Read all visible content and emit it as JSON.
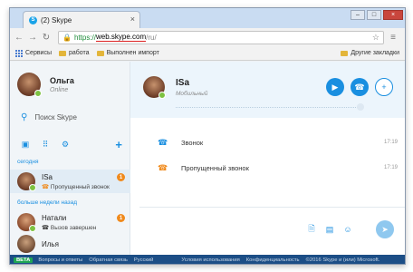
{
  "browser": {
    "tab_title": "(2) Skype",
    "tab_badge": "S",
    "url_scheme": "https://",
    "url_host": "web.skype.com",
    "url_path": "/ru/",
    "bookmarks": [
      {
        "label": "Сервисы",
        "icon": "apps-icon"
      },
      {
        "label": "работа",
        "icon": "folder-icon"
      },
      {
        "label": "Выполнен импорт",
        "icon": "folder-icon"
      }
    ],
    "other_bookmarks": "Другие закладки"
  },
  "profile": {
    "name": "Ольга",
    "status": "Online"
  },
  "search": {
    "label": "Поиск Skype"
  },
  "sections": {
    "today": "сегодня",
    "older": "больше недели назад"
  },
  "contacts": [
    {
      "name": "ISa",
      "sub": "Пропущенный звонок",
      "badge": "1",
      "active": true
    },
    {
      "name": "Натали",
      "sub": "Вызов завершен",
      "badge": "1",
      "active": false
    },
    {
      "name": "Илья",
      "sub": "",
      "badge": "",
      "active": false
    }
  ],
  "chat": {
    "name": "ISa",
    "sub": "Мобильный",
    "messages": [
      {
        "text": "Звонок",
        "time": "17:19",
        "icon": "phone-icon"
      },
      {
        "text": "Пропущенный звонок",
        "time": "17:19",
        "icon": "missed-call-icon"
      }
    ]
  },
  "footer": {
    "beta": "BETA",
    "links": [
      "Вопросы и ответы",
      "Обратная связь",
      "Русский"
    ],
    "right_links": [
      "Условия использования",
      "Конфиденциальность",
      "©2016 Skype и (или) Microsoft."
    ]
  },
  "colors": {
    "accent": "#1a8fe0",
    "badge": "#f08a1c",
    "footer": "#1c4e86",
    "online": "#7dc242"
  }
}
